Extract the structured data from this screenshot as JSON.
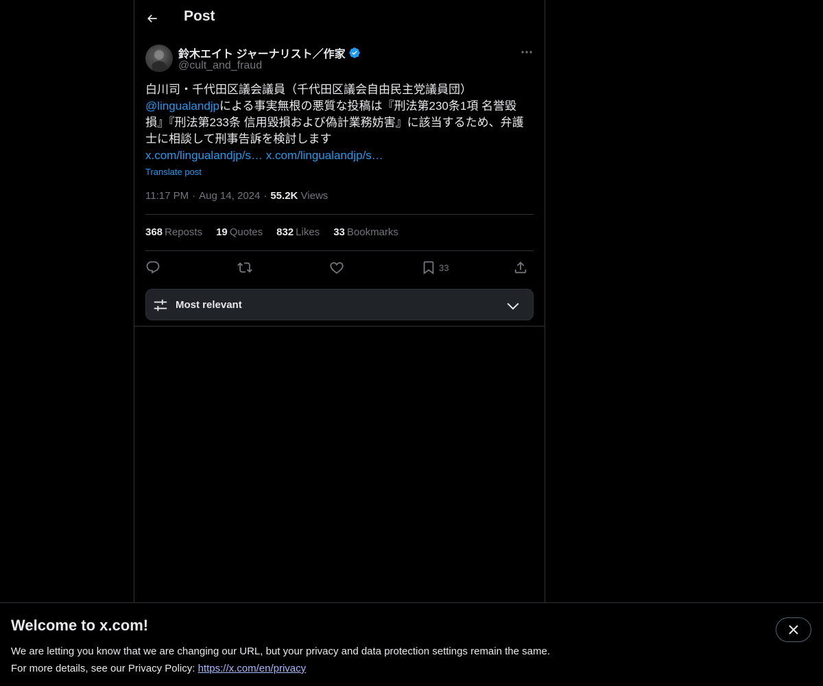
{
  "header": {
    "title": "Post"
  },
  "author": {
    "name": "鈴木エイト ジャーナリスト／作家",
    "handle": "@cult_and_fraud"
  },
  "post": {
    "line1": "白川司・千代田区議会議員（千代田区議会自由民主党議員団）",
    "mention": "@lingualandjp",
    "body_after_mention": "による事実無根の悪質な投稿は『刑法第230条1項 名誉毀損』『刑法第233条 信用毀損および偽計業務妨害』に該当するため、弁護士に相談して刑事告訴を検討します",
    "link1": "x.com/lingualandjp/s…",
    "link2": "x.com/lingualandjp/s…",
    "translate_label": "Translate post"
  },
  "meta": {
    "time": "11:17 PM",
    "date": "Aug 14, 2024",
    "views_count": "55.2K",
    "views_label": "Views"
  },
  "stats": {
    "reposts_count": "368",
    "reposts_label": "Reposts",
    "quotes_count": "19",
    "quotes_label": "Quotes",
    "likes_count": "832",
    "likes_label": "Likes",
    "bookmarks_count": "33",
    "bookmarks_label": "Bookmarks"
  },
  "actions": {
    "bookmark_count": "33"
  },
  "sort": {
    "label": "Most relevant"
  },
  "banner": {
    "title": "Welcome to x.com!",
    "line1": "We are letting you know that we are changing our URL, but your privacy and data protection settings remain the same.",
    "line2_prefix": "For more details, see our Privacy Policy: ",
    "privacy_link": "https://x.com/en/privacy"
  },
  "colors": {
    "accent": "#1d9bf0",
    "muted": "#71767b",
    "border": "#2f3336"
  }
}
